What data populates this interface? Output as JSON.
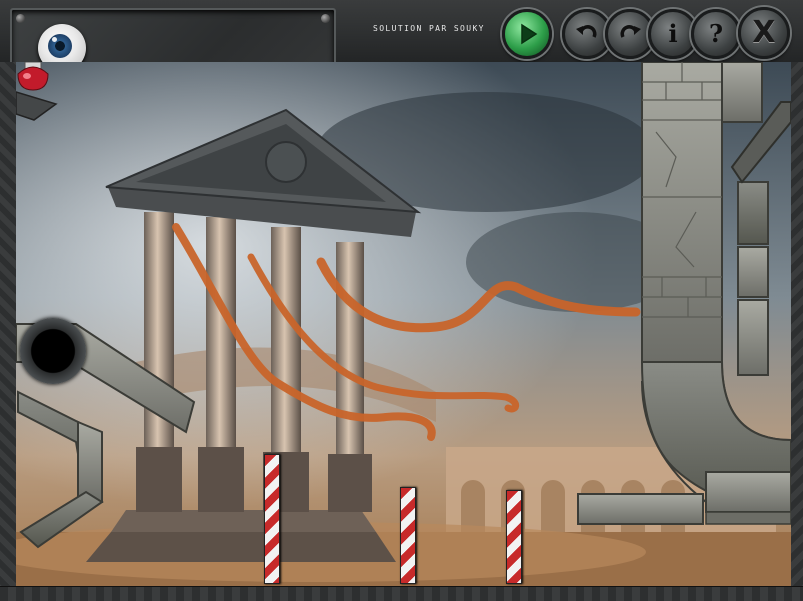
{
  "toolbar": {
    "solution_label": "SOLUTION PAR SOUKY",
    "buttons": [
      {
        "id": "play",
        "icon": "play-icon"
      },
      {
        "id": "undo",
        "icon": "undo-icon"
      },
      {
        "id": "redo",
        "icon": "redo-icon"
      },
      {
        "id": "info",
        "icon": "info-icon",
        "glyph": "i"
      },
      {
        "id": "help",
        "icon": "help-icon",
        "glyph": "?"
      },
      {
        "id": "close",
        "icon": "close-icon",
        "glyph": "X"
      }
    ]
  },
  "colors": {
    "play_green": "#2d9e49",
    "ribbon": "#c8642a",
    "pole_red": "#c72a2a",
    "stone": "#8e8f88"
  },
  "scene": {
    "objects": [
      "eye-ball",
      "exit-hole",
      "red-bulb",
      "temple",
      "ribbons",
      "striped-poles",
      "stone-blocks"
    ]
  }
}
